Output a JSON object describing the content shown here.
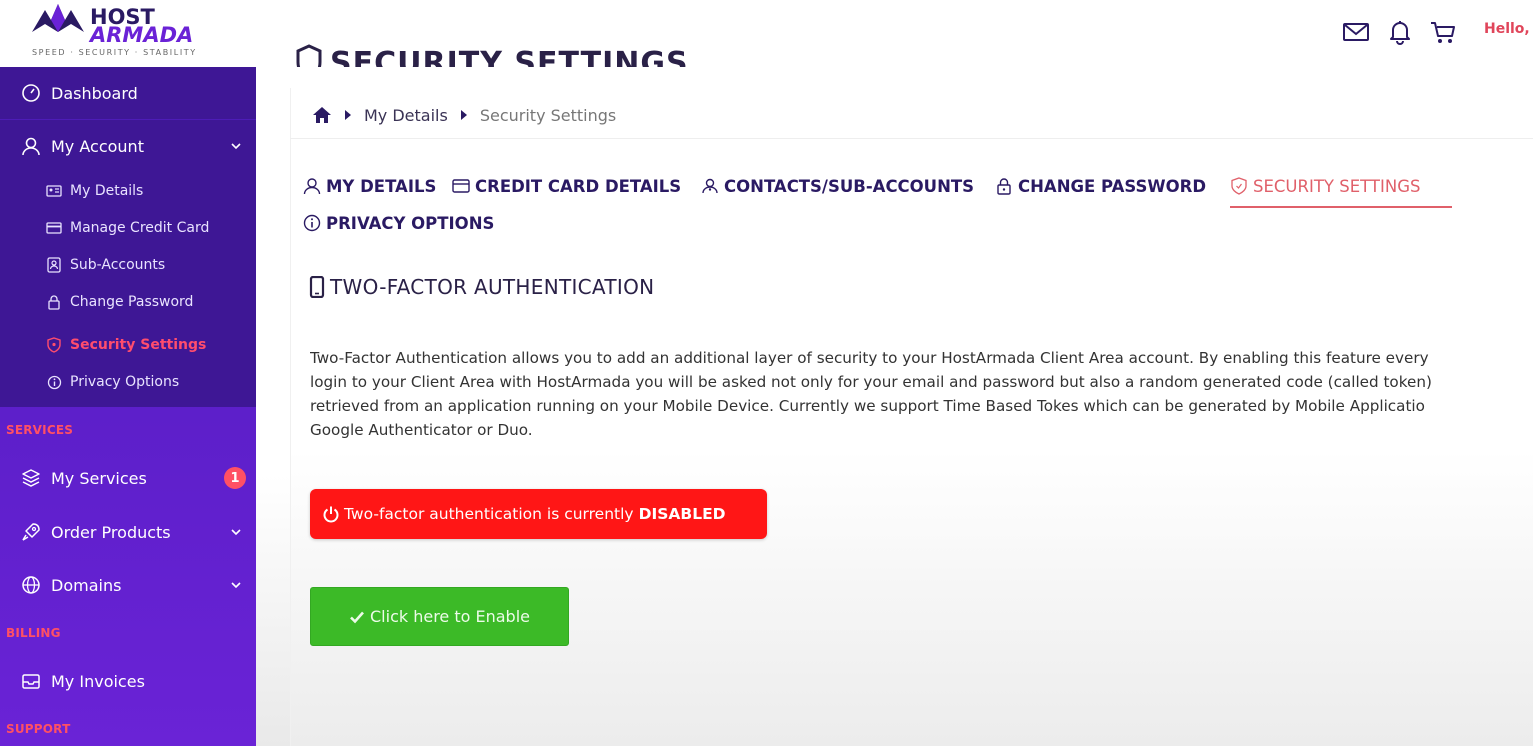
{
  "brand": {
    "name_line1": "HOST",
    "name_line2": "ARMADA",
    "tagline": "SPEED · SECURITY · STABILITY",
    "primary_color": "#4a1cb3",
    "accent_color": "#ff5064"
  },
  "header": {
    "icons": [
      "mail-icon",
      "bell-icon",
      "cart-icon"
    ],
    "greeting": "Hello, I"
  },
  "sidebar": {
    "dashboard": "Dashboard",
    "my_account": "My Account",
    "account_items": [
      {
        "label": "My Details",
        "icon": "id-card-icon"
      },
      {
        "label": "Manage Credit Card",
        "icon": "credit-card-icon"
      },
      {
        "label": "Sub-Accounts",
        "icon": "contact-icon"
      },
      {
        "label": "Change Password",
        "icon": "lock-icon"
      },
      {
        "label": "Security Settings",
        "icon": "shield-icon"
      },
      {
        "label": "Privacy Options",
        "icon": "info-icon"
      }
    ],
    "section_services": "SERVICES",
    "my_services": "My Services",
    "my_services_badge": "1",
    "order_products": "Order Products",
    "domains": "Domains",
    "section_billing": "BILLING",
    "my_invoices": "My Invoices",
    "section_support": "SUPPORT"
  },
  "page": {
    "title": "SECURITY SETTINGS",
    "breadcrumb": [
      "My Details",
      "Security Settings"
    ]
  },
  "tabs": [
    {
      "label": "MY DETAILS"
    },
    {
      "label": "CREDIT CARD DETAILS"
    },
    {
      "label": "CONTACTS/SUB-ACCOUNTS"
    },
    {
      "label": "CHANGE PASSWORD"
    },
    {
      "label": "SECURITY SETTINGS"
    },
    {
      "label": "PRIVACY OPTIONS"
    }
  ],
  "two_factor": {
    "heading": "TWO-FACTOR AUTHENTICATION",
    "description_lines": [
      "Two-Factor Authentication allows you to add an additional layer of security to your HostArmada Client Area account. By enabling this feature every",
      "login to your Client Area with HostArmada you will be asked not only for your email and password but also a random generated code (called token)",
      "retrieved from an application running on your Mobile Device. Currently we support Time Based Tokes which can be generated by Mobile Applicatio",
      "Google Authenticator or Duo."
    ],
    "status_prefix": "Two-factor authentication is currently",
    "status_value": "DISABLED",
    "enable_button": "Click here to Enable"
  }
}
